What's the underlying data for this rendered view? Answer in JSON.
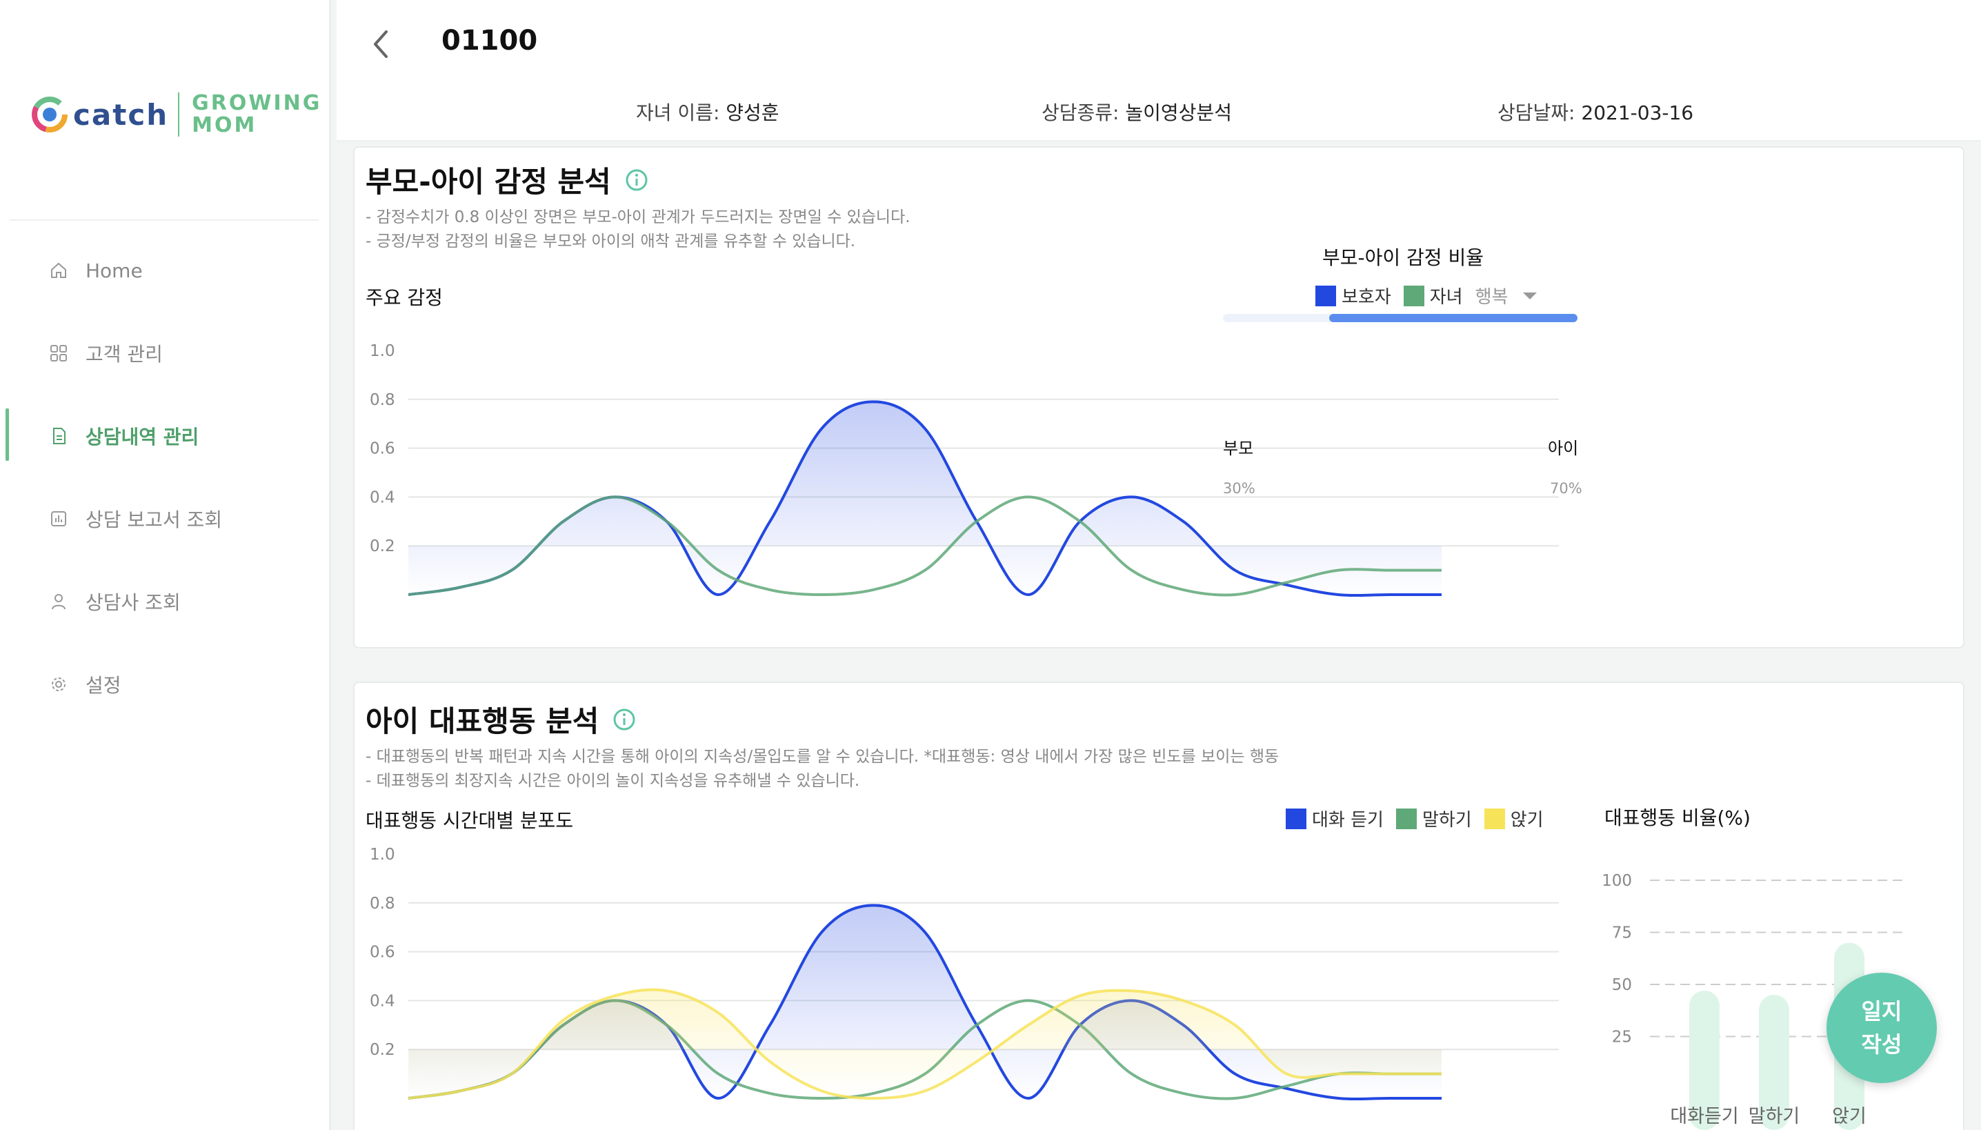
{
  "sidebar": {
    "logo": {
      "catch": "catch",
      "growing": "GROWING",
      "mom": "MOM"
    },
    "items": [
      {
        "label": "Home",
        "icon": "home-icon"
      },
      {
        "label": "고객 관리",
        "icon": "grid-icon"
      },
      {
        "label": "상담내역 관리",
        "icon": "document-icon",
        "active": true
      },
      {
        "label": "상담 보고서 조회",
        "icon": "report-icon"
      },
      {
        "label": "상담사 조회",
        "icon": "person-icon"
      },
      {
        "label": "설정",
        "icon": "gear-icon"
      }
    ]
  },
  "header": {
    "title": "01100",
    "child_name_label": "자녀 이름:",
    "child_name": "양성훈",
    "type_label": "상담종류:",
    "type": "놀이영상분석",
    "date_label": "상담날짜:",
    "date": "2021-03-16"
  },
  "emotion": {
    "title": "부모-아이 감정 분석",
    "desc1": "- 감정수치가 0.8 이상인 장면은 부모-아이 관계가 두드러지는 장면일 수 있습니다.",
    "desc2": "- 긍정/부정 감정의 비율은 부모와 아이의 애착 관계를 유추할 수 있습니다.",
    "chart_title": "주요 감정",
    "legend_guardian": "보호자",
    "legend_child": "자녀",
    "dropdown": "행복",
    "ratio_title": "부모-아이 감정 비율",
    "ratio_left": "부모",
    "ratio_right": "아이",
    "ratio_left_pct": "30%",
    "ratio_right_pct": "70%",
    "ratio_child_fraction": 0.7
  },
  "behavior": {
    "title": "아이 대표행동 분석",
    "desc1": "- 대표행동의 반복 패턴과 지속 시간을 통해 아이의 지속성/몰입도를 알 수 있습니다. *대표행동: 영상 내에서 가장 많은 빈도를 보이는 행동",
    "desc2": "- 데표행동의 최장지속 시간은 아이의 놀이 지속성을 유추해낼 수 있습니다.",
    "chart_title": "대표행동 시간대별 분포도",
    "legend1": "대화 듣기",
    "legend2": "말하기",
    "legend3": "앉기",
    "bar_title": "대표행동 비율(%)"
  },
  "fab": {
    "line1": "일지",
    "line2": "작성"
  },
  "colors": {
    "blue": "#2348e0",
    "green": "#5fa878",
    "yellow": "#f7e35a",
    "accent": "#6abf8a",
    "fab": "#63cbb0"
  },
  "chart_data": [
    {
      "type": "line",
      "title": "주요 감정",
      "ylim": [
        0,
        1.0
      ],
      "yticks": [
        "1.0",
        "0.8",
        "0.6",
        "0.4",
        "0.2"
      ],
      "x": [
        0,
        1,
        2,
        3,
        4,
        5,
        6,
        7,
        8,
        9,
        10,
        11,
        12,
        13,
        14,
        15,
        16,
        17,
        18,
        19,
        20
      ],
      "series": [
        {
          "name": "보호자",
          "color": "#2348e0",
          "fill": true,
          "values": [
            0.0,
            0.03,
            0.1,
            0.3,
            0.4,
            0.3,
            0.0,
            0.3,
            0.68,
            0.79,
            0.68,
            0.3,
            0.0,
            0.3,
            0.4,
            0.3,
            0.1,
            0.04,
            0.0,
            0.0,
            0.0
          ]
        },
        {
          "name": "자녀",
          "color": "#5fa878",
          "fill": false,
          "values": [
            0.0,
            0.03,
            0.1,
            0.3,
            0.4,
            0.3,
            0.1,
            0.02,
            0.0,
            0.02,
            0.1,
            0.3,
            0.4,
            0.3,
            0.1,
            0.02,
            0.0,
            0.05,
            0.1,
            0.1,
            0.1
          ]
        }
      ],
      "legend": "top-right",
      "grid": true
    },
    {
      "type": "line",
      "title": "대표행동 시간대별 분포도",
      "ylim": [
        0,
        1.0
      ],
      "yticks": [
        "1.0",
        "0.8",
        "0.6",
        "0.4",
        "0.2"
      ],
      "x": [
        0,
        1,
        2,
        3,
        4,
        5,
        6,
        7,
        8,
        9,
        10,
        11,
        12,
        13,
        14,
        15,
        16,
        17,
        18,
        19,
        20
      ],
      "series": [
        {
          "name": "대화 듣기",
          "color": "#2348e0",
          "fill": true,
          "values": [
            0.0,
            0.03,
            0.1,
            0.3,
            0.4,
            0.3,
            0.0,
            0.3,
            0.68,
            0.79,
            0.68,
            0.3,
            0.0,
            0.3,
            0.4,
            0.3,
            0.1,
            0.04,
            0.0,
            0.0,
            0.0
          ]
        },
        {
          "name": "말하기",
          "color": "#5fa878",
          "fill": false,
          "values": [
            0.0,
            0.03,
            0.1,
            0.3,
            0.4,
            0.3,
            0.1,
            0.02,
            0.0,
            0.02,
            0.1,
            0.3,
            0.4,
            0.3,
            0.1,
            0.02,
            0.0,
            0.05,
            0.1,
            0.1,
            0.1
          ]
        },
        {
          "name": "앉기",
          "color": "#f7e35a",
          "fill": true,
          "values": [
            0.0,
            0.03,
            0.1,
            0.32,
            0.42,
            0.44,
            0.35,
            0.15,
            0.03,
            0.0,
            0.03,
            0.15,
            0.3,
            0.42,
            0.44,
            0.4,
            0.3,
            0.1,
            0.1,
            0.1,
            0.1
          ]
        }
      ],
      "legend": "top-right",
      "grid": true
    },
    {
      "type": "bar",
      "title": "대표행동 비율(%)",
      "categories": [
        "대화듣기",
        "말하기",
        "앉기"
      ],
      "values": [
        47,
        45,
        70
      ],
      "ylim": [
        0,
        100
      ],
      "yticks": [
        "100",
        "75",
        "50",
        "25"
      ],
      "grid": true
    }
  ]
}
